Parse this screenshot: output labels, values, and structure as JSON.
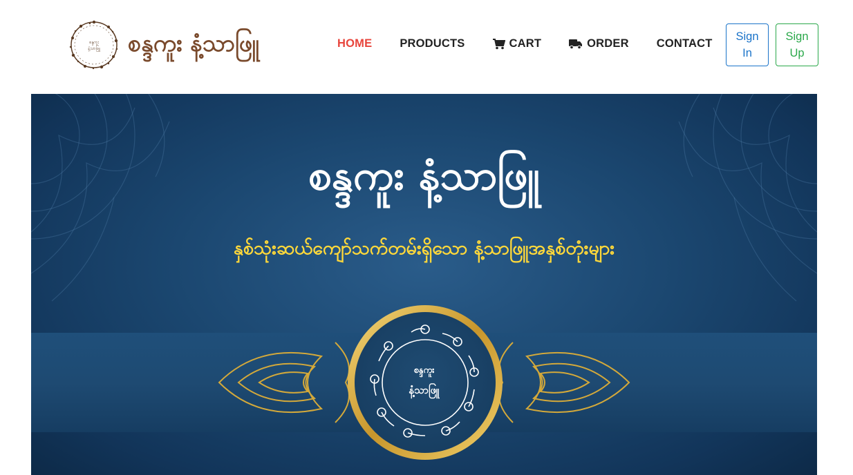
{
  "brand": {
    "name": "စန္ဒကူး နံ့သာဖြူ",
    "emblem_text_line1": "စန္ဒကူး",
    "emblem_text_line2": "နံ့သာဖြူ"
  },
  "nav": {
    "items": [
      {
        "label": "HOME",
        "icon": null,
        "active": true
      },
      {
        "label": "PRODUCTS",
        "icon": null,
        "active": false
      },
      {
        "label": "CART",
        "icon": "cart-icon",
        "active": false
      },
      {
        "label": "ORDER",
        "icon": "truck-icon",
        "active": false
      },
      {
        "label": "CONTACT",
        "icon": null,
        "active": false
      }
    ]
  },
  "auth": {
    "signin_line1": "Sign",
    "signin_line2": "In",
    "signup_line1": "Sign",
    "signup_line2": "Up"
  },
  "banner": {
    "title": "စန္ဒကူး နံ့သာဖြူ",
    "subtitle": "နှစ်သုံးဆယ်ကျော်သက်တမ်းရှိသော နံ့သာဖြူအနှစ်တုံးများ",
    "seal_line1": "စန္ဒကူး",
    "seal_line2": "နံ့သာဖြူ"
  },
  "colors": {
    "brand_brown": "#7a4a2c",
    "active_nav": "#e8453c",
    "signin_blue": "#1a73c9",
    "signup_green": "#2aa84a",
    "banner_navy": "#1b4770",
    "subtitle_yellow": "#ffd83a",
    "gold": "#d4a93a"
  }
}
